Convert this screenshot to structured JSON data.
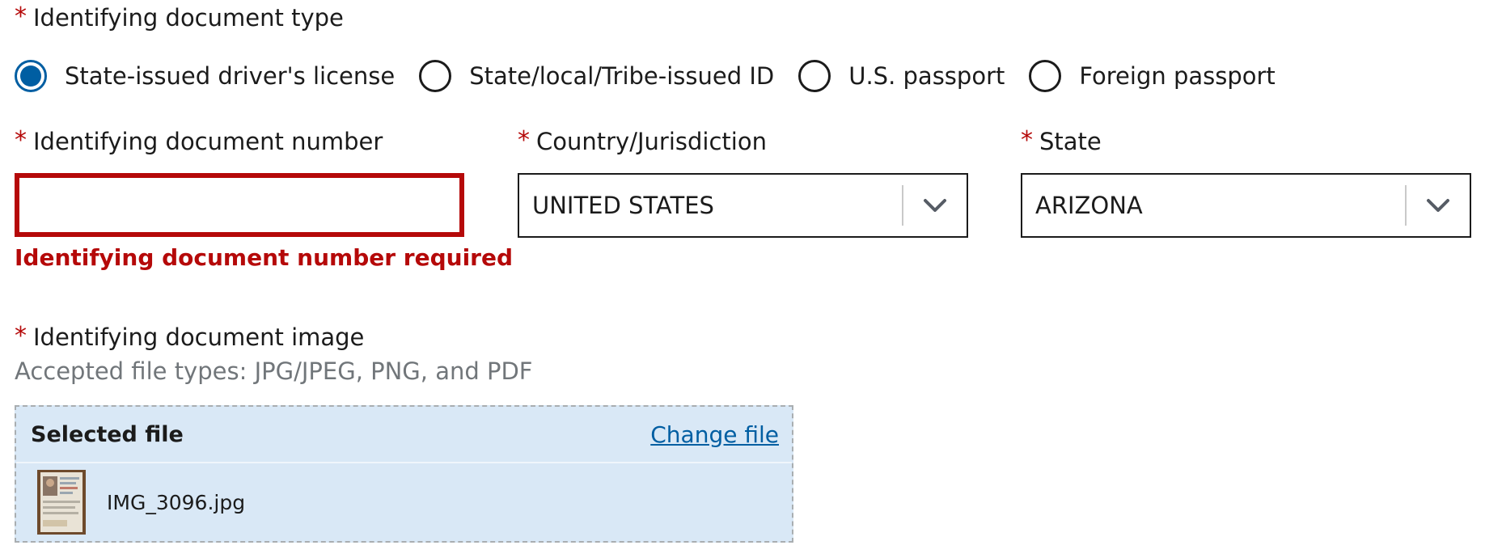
{
  "required_marker": "*",
  "doc_type": {
    "label": "Identifying document type",
    "options": [
      {
        "label": "State-issued driver's license",
        "checked": true
      },
      {
        "label": "State/local/Tribe-issued ID",
        "checked": false
      },
      {
        "label": "U.S. passport",
        "checked": false
      },
      {
        "label": "Foreign passport",
        "checked": false
      }
    ]
  },
  "doc_number": {
    "label": "Identifying document number",
    "value": "",
    "error": "Identifying document number required"
  },
  "country": {
    "label": "Country/Jurisdiction",
    "selected": "UNITED STATES"
  },
  "state": {
    "label": "State",
    "selected": "ARIZONA"
  },
  "doc_image": {
    "label": "Identifying document image",
    "hint": "Accepted file types: JPG/JPEG, PNG, and PDF",
    "selected_heading": "Selected file",
    "change_link": "Change file",
    "file_name": "IMG_3096.jpg"
  },
  "colors": {
    "error": "#b50909",
    "primary": "#005ea2",
    "file_box_bg": "#d9e8f6"
  },
  "icons": [
    "chevron-down-icon",
    "file-thumbnail-icon"
  ]
}
